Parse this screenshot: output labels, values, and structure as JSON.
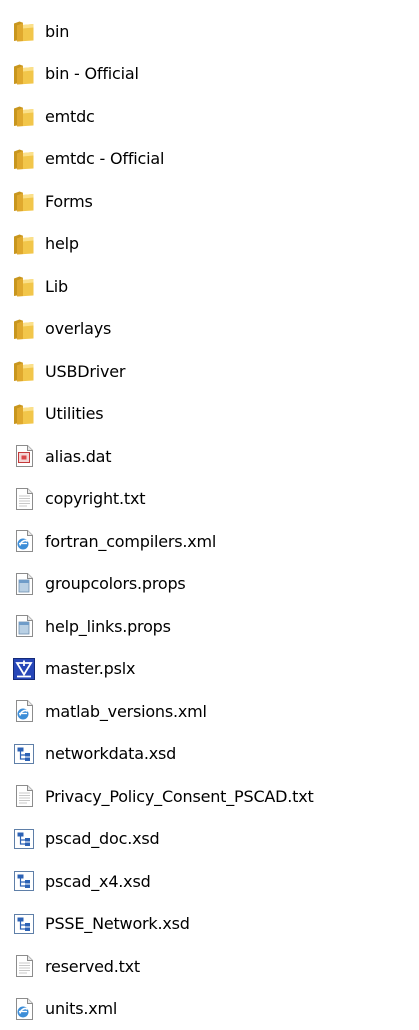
{
  "files": [
    {
      "name": "bin",
      "icon": "folder-icon"
    },
    {
      "name": "bin - Official",
      "icon": "folder-icon"
    },
    {
      "name": "emtdc",
      "icon": "folder-icon"
    },
    {
      "name": "emtdc - Official",
      "icon": "folder-icon"
    },
    {
      "name": "Forms",
      "icon": "folder-icon"
    },
    {
      "name": "help",
      "icon": "folder-icon"
    },
    {
      "name": "Lib",
      "icon": "folder-icon"
    },
    {
      "name": "overlays",
      "icon": "folder-icon"
    },
    {
      "name": "USBDriver",
      "icon": "folder-icon"
    },
    {
      "name": "Utilities",
      "icon": "folder-icon"
    },
    {
      "name": "alias.dat",
      "icon": "dat-file-icon"
    },
    {
      "name": "copyright.txt",
      "icon": "text-file-icon"
    },
    {
      "name": "fortran_compilers.xml",
      "icon": "xml-file-icon"
    },
    {
      "name": "groupcolors.props",
      "icon": "props-file-icon"
    },
    {
      "name": "help_links.props",
      "icon": "props-file-icon"
    },
    {
      "name": "master.pslx",
      "icon": "pscad-project-icon"
    },
    {
      "name": "matlab_versions.xml",
      "icon": "xml-file-icon"
    },
    {
      "name": "networkdata.xsd",
      "icon": "xsd-file-icon"
    },
    {
      "name": "Privacy_Policy_Consent_PSCAD.txt",
      "icon": "text-file-icon"
    },
    {
      "name": "pscad_doc.xsd",
      "icon": "xsd-file-icon"
    },
    {
      "name": "pscad_x4.xsd",
      "icon": "xsd-file-icon"
    },
    {
      "name": "PSSE_Network.xsd",
      "icon": "xsd-file-icon"
    },
    {
      "name": "reserved.txt",
      "icon": "text-file-icon"
    },
    {
      "name": "units.xml",
      "icon": "xml-file-icon"
    }
  ]
}
